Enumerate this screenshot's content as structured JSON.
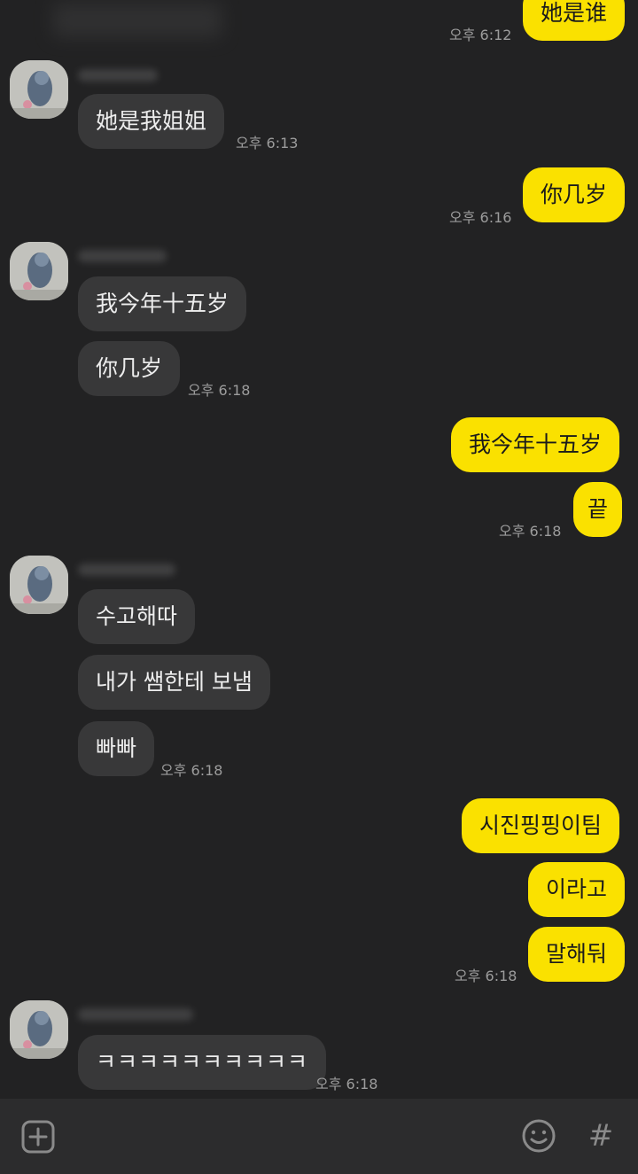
{
  "messages": [
    {
      "text": "她是谁"
    },
    {
      "time": "오후 6:12"
    },
    {
      "text": "她是我姐姐"
    },
    {
      "time": "오후 6:13"
    },
    {
      "text": "你几岁"
    },
    {
      "time": "오후 6:16"
    },
    {
      "text": "我今年十五岁"
    },
    {
      "text": "你几岁"
    },
    {
      "time": "오후 6:18"
    },
    {
      "text": "我今年十五岁"
    },
    {
      "text": "끝"
    },
    {
      "time": "오후 6:18"
    },
    {
      "text": "수고해따"
    },
    {
      "text": "내가 쌤한테 보냄"
    },
    {
      "text": "빠빠"
    },
    {
      "time": "오후 6:18"
    },
    {
      "text": "시진핑핑이팀"
    },
    {
      "text": "이라고"
    },
    {
      "text": "말해둬"
    },
    {
      "time": "오후 6:18"
    },
    {
      "text": "ㅋㅋㅋㅋㅋㅋㅋㅋㅋㅋ"
    },
    {
      "time": "오후 6:18"
    }
  ],
  "input_bar": {
    "add_icon": "plus-square-icon",
    "emoji_icon": "smiley-icon",
    "hash_label": "#"
  },
  "colors": {
    "background": "#222223",
    "incoming_bubble": "#383839",
    "outgoing_bubble": "#fae100",
    "timestamp": "#9c9c9c"
  }
}
